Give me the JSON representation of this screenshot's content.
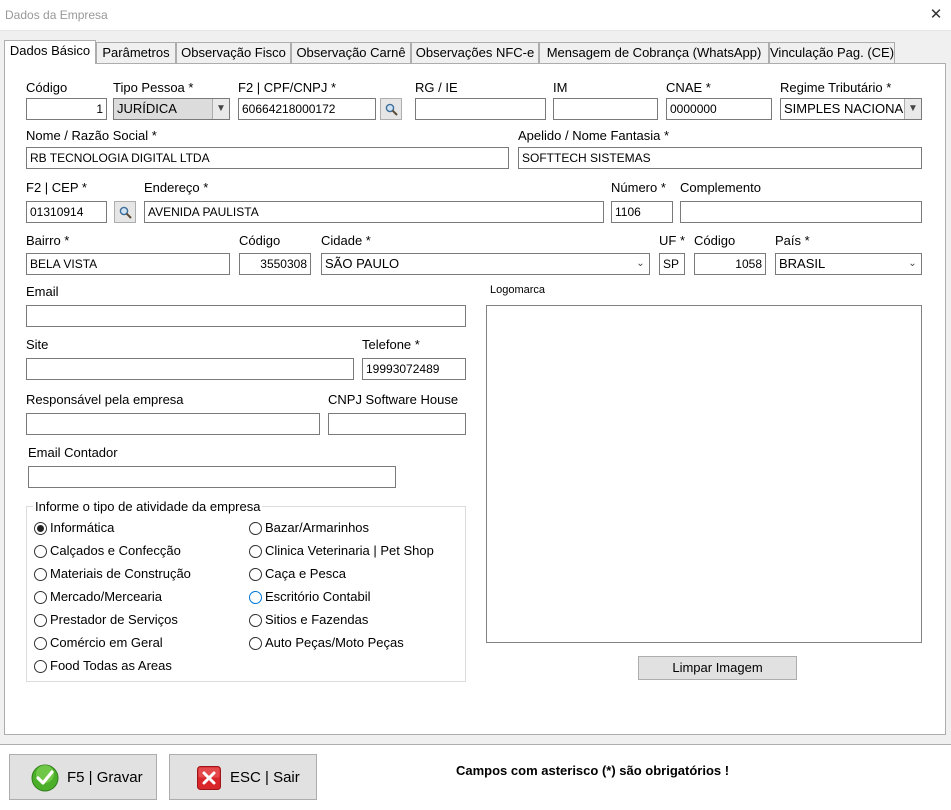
{
  "window": {
    "title": "Dados da Empresa",
    "close": "✕"
  },
  "tabs": [
    "Dados Básico",
    "Parâmetros",
    "Observação Fisco",
    "Observação Carnê",
    "Observações NFC-e",
    "Mensagem de Cobrança (WhatsApp)",
    "Vinculação Pag. (CE)"
  ],
  "fields": {
    "codigo": {
      "label": "Código",
      "value": "1"
    },
    "tipo_pessoa": {
      "label": "Tipo Pessoa *",
      "value": "JURÍDICA"
    },
    "cpf_cnpj": {
      "label": "F2 | CPF/CNPJ *",
      "value": "60664218000172"
    },
    "rg_ie": {
      "label": "RG / IE",
      "value": ""
    },
    "im": {
      "label": "IM",
      "value": ""
    },
    "cnae": {
      "label": "CNAE *",
      "value": "0000000"
    },
    "regime": {
      "label": "Regime Tributário *",
      "value": "SIMPLES NACIONAL"
    },
    "nome": {
      "label": "Nome / Razão Social *",
      "value": "RB TECNOLOGIA DIGITAL LTDA"
    },
    "fantasia": {
      "label": "Apelido / Nome Fantasia *",
      "value": "SOFTTECH SISTEMAS"
    },
    "cep": {
      "label": "F2 | CEP *",
      "value": "01310914"
    },
    "endereco": {
      "label": "Endereço *",
      "value": "AVENIDA PAULISTA"
    },
    "numero": {
      "label": "Número *",
      "value": "1106"
    },
    "complemento": {
      "label": "Complemento",
      "value": ""
    },
    "bairro": {
      "label": "Bairro *",
      "value": "BELA VISTA"
    },
    "codigo_cidade": {
      "label": "Código",
      "value": "3550308"
    },
    "cidade": {
      "label": "Cidade *",
      "value": "SÃO PAULO"
    },
    "uf": {
      "label": "UF *",
      "value": "SP"
    },
    "codigo_pais": {
      "label": "Código",
      "value": "1058"
    },
    "pais": {
      "label": "País *",
      "value": "BRASIL"
    },
    "email": {
      "label": "Email",
      "value": ""
    },
    "site": {
      "label": "Site",
      "value": ""
    },
    "telefone": {
      "label": "Telefone *",
      "value": "19993072489"
    },
    "responsavel": {
      "label": "Responsável pela empresa",
      "value": ""
    },
    "cnpj_software": {
      "label": "CNPJ Software House",
      "value": ""
    },
    "email_contador": {
      "label": "Email Contador",
      "value": ""
    }
  },
  "atividade": {
    "legend": "Informe o tipo de atividade da empresa",
    "options": [
      "Informática",
      "Calçados e Confecção",
      "Materiais de Construção",
      "Mercado/Mercearia",
      "Prestador de Serviços",
      "Comércio em Geral",
      "Food Todas as Areas",
      "Bazar/Armarinhos",
      "Clinica Veterinaria | Pet Shop",
      "Caça e Pesca",
      "Escritório Contabil",
      "Sitios e Fazendas",
      "Auto Peças/Moto Peças"
    ],
    "selected": "Informática"
  },
  "logomarca": {
    "label": "Logomarca",
    "clear_button": "Limpar Imagem"
  },
  "footer": {
    "save_button": "F5 | Gravar",
    "exit_button": "ESC | Sair",
    "note": "Campos com asterisco (*) são obrigatórios !"
  },
  "colors": {
    "save_icon": "#4caf2a",
    "exit_icon": "#d9262b",
    "focus": "#0078d7"
  }
}
